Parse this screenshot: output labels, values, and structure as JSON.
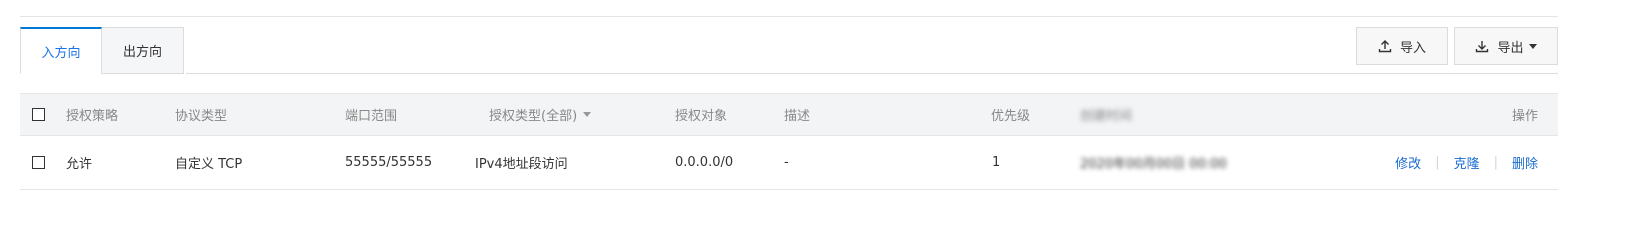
{
  "tabs": [
    {
      "label": "入方向",
      "active": true
    },
    {
      "label": "出方向",
      "active": false
    }
  ],
  "toolbar": {
    "import_label": "导入",
    "export_label": "导出",
    "import_icon": "upload-icon",
    "export_icon": "download-icon"
  },
  "table": {
    "headers": {
      "policy": "授权策略",
      "protocol": "协议类型",
      "port_range": "端口范围",
      "auth_type": "授权类型(全部)",
      "auth_object": "授权对象",
      "description": "描述",
      "priority": "优先级",
      "blurred_col": "创建时间",
      "actions": "操作"
    },
    "rows": [
      {
        "policy": "允许",
        "protocol": "自定义 TCP",
        "port_range": "55555/55555",
        "auth_type": "IPv4地址段访问",
        "auth_object": "0.0.0.0/0",
        "description": "-",
        "priority": "1",
        "blurred_value": "2020年00月00日 00:00",
        "actions": {
          "modify": "修改",
          "clone": "克隆",
          "delete": "删除"
        }
      }
    ]
  },
  "colors": {
    "accent": "#1a6bd0",
    "tab_active_border": "#0079d6",
    "header_bg": "#f2f4f5"
  }
}
